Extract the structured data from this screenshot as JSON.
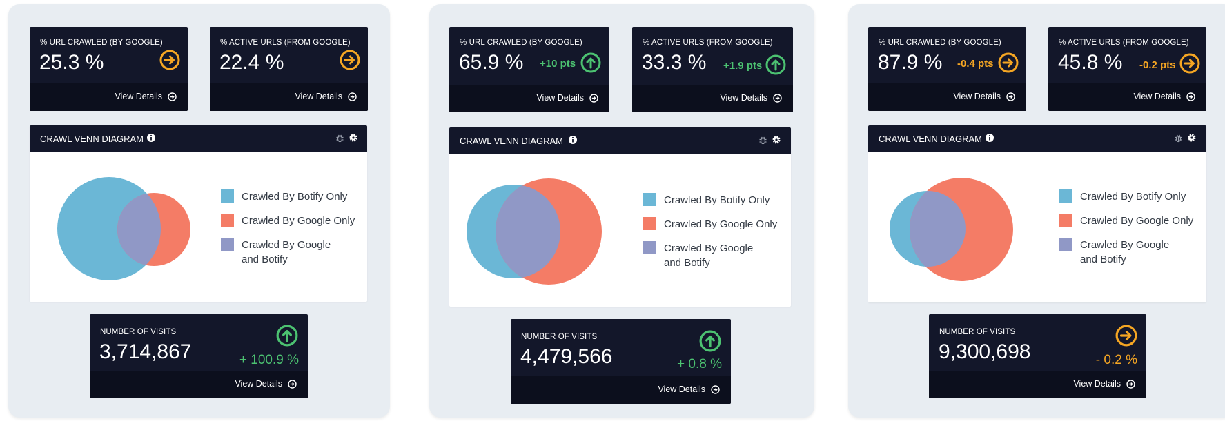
{
  "colors": {
    "botify_only": "#6bb7d6",
    "google_only": "#f47c66",
    "both": "#9098c6",
    "panel_bg": "#e8edf2",
    "card_dark": "#13172a",
    "footer_dark": "#0c0f1d",
    "up_green": "#4cc271",
    "neutral_orange": "#f5a623"
  },
  "common": {
    "view_details": "View Details",
    "venn_title": "CRAWL VENN DIAGRAM",
    "legend": [
      "Crawled By Botify Only",
      "Crawled By Google Only",
      "Crawled By Google",
      "and Botify"
    ]
  },
  "panels": [
    {
      "url_crawled": {
        "label": "% URL CRAWLED (BY GOOGLE)",
        "value": "25.3 %",
        "delta": "",
        "trend": "neutral",
        "icon": "arrow-right-circle-icon"
      },
      "active_urls": {
        "label": "% ACTIVE URLS (FROM GOOGLE)",
        "value": "22.4 %",
        "delta": "",
        "trend": "neutral",
        "icon": "arrow-right-circle-icon"
      },
      "visits": {
        "label": "NUMBER OF VISITS",
        "value": "3,714,867",
        "delta": "+ 100.9 %",
        "trend": "up",
        "icon": "arrow-up-circle-icon"
      }
    },
    {
      "url_crawled": {
        "label": "% URL CRAWLED (BY GOOGLE)",
        "value": "65.9 %",
        "delta": "+10 pts",
        "trend": "up",
        "icon": "arrow-up-circle-icon"
      },
      "active_urls": {
        "label": "% ACTIVE URLS (FROM GOOGLE)",
        "value": "33.3 %",
        "delta": "+1.9 pts",
        "trend": "up",
        "icon": "arrow-up-circle-icon"
      },
      "visits": {
        "label": "NUMBER OF VISITS",
        "value": "4,479,566",
        "delta": "+ 0.8 %",
        "trend": "up",
        "icon": "arrow-up-circle-icon"
      }
    },
    {
      "url_crawled": {
        "label": "% URL CRAWLED (BY GOOGLE)",
        "value": "87.9 %",
        "delta": "-0.4 pts",
        "trend": "neutral",
        "icon": "arrow-right-circle-icon"
      },
      "active_urls": {
        "label": "% ACTIVE URLS (FROM GOOGLE)",
        "value": "45.8 %",
        "delta": "-0.2 pts",
        "trend": "neutral",
        "icon": "arrow-right-circle-icon"
      },
      "visits": {
        "label": "NUMBER OF VISITS",
        "value": "9,300,698",
        "delta": "- 0.2 %",
        "trend": "neutral",
        "icon": "arrow-right-circle-icon"
      }
    }
  ]
}
